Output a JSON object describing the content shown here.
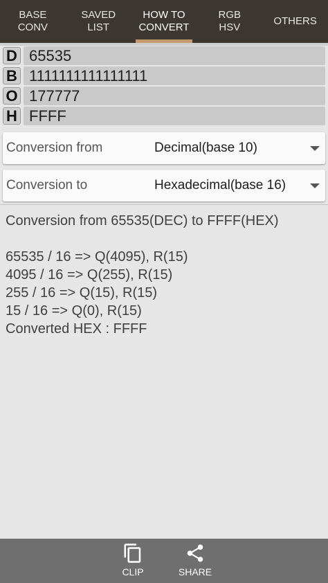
{
  "tabs": [
    {
      "line1": "BASE",
      "line2": "CONV"
    },
    {
      "line1": "SAVED",
      "line2": "LIST"
    },
    {
      "line1": "HOW TO",
      "line2": "CONVERT"
    },
    {
      "line1": "RGB",
      "line2": "HSV"
    },
    {
      "line1": "OTHERS",
      "line2": ""
    }
  ],
  "values": [
    {
      "letter": "D",
      "value": "65535"
    },
    {
      "letter": "B",
      "value": "1111111111111111"
    },
    {
      "letter": "O",
      "value": "177777"
    },
    {
      "letter": "H",
      "value": "FFFF"
    }
  ],
  "conversion_from": {
    "label": "Conversion from",
    "value": "Decimal(base 10)"
  },
  "conversion_to": {
    "label": "Conversion to",
    "value": "Hexadecimal(base 16)"
  },
  "explanation": {
    "header": "Conversion from 65535(DEC) to FFFF(HEX)",
    "steps": [
      "65535 / 16 => Q(4095), R(15)",
      "4095 / 16 => Q(255), R(15)",
      "255 / 16 => Q(15), R(15)",
      "15 / 16 => Q(0), R(15)",
      "Converted HEX : FFFF"
    ]
  },
  "bottom": {
    "clip_label": "CLIP",
    "share_label": "SHARE"
  },
  "colors": {
    "tabbar": "#3c3731",
    "indicator": "#c49a6c",
    "bottombar": "#6f6f6f"
  },
  "icons": {
    "clip": "copy-icon",
    "share": "share-icon"
  }
}
